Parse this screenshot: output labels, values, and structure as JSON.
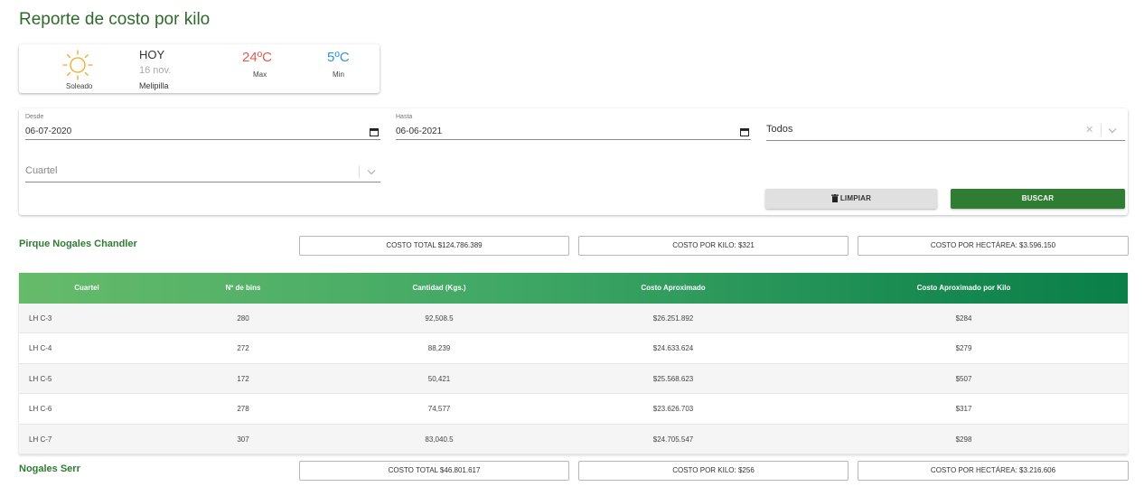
{
  "page": {
    "title": "Reporte de costo por kilo"
  },
  "weather": {
    "condition": "Soleado",
    "icon": "sun-icon",
    "day_label": "HOY",
    "date": "16 nov.",
    "location": "Melipilla",
    "max_temp": "24ºC",
    "max_label": "Max",
    "min_temp": "5ºC",
    "min_label": "Min",
    "colors": {
      "max": "#e05b52",
      "min": "#2d95d9",
      "sun": "#f5a623"
    }
  },
  "filters": {
    "desde": {
      "label": "Desde",
      "value": "06-07-2020"
    },
    "hasta": {
      "label": "Hasta",
      "value": "06-06-2021"
    },
    "campo_select": {
      "value": "Todos"
    },
    "cuartel_select": {
      "placeholder": "Cuartel"
    },
    "clear_label": "LIMPIAR",
    "search_label": "BUSCAR"
  },
  "sections": [
    {
      "name": "Pirque Nogales Chandler",
      "costo_total": "COSTO TOTAL $124.786.389",
      "costo_kilo": "COSTO POR KILO: $321",
      "costo_hectarea": "COSTO POR HECTÁREA: $3.596.150"
    },
    {
      "name": "Nogales Serr",
      "costo_total": "COSTO TOTAL $46.801.617",
      "costo_kilo": "COSTO POR KILO: $256",
      "costo_hectarea": "COSTO POR HECTÁREA: $3.216.606"
    }
  ],
  "table": {
    "headers": [
      "Cuartel",
      "Nº de bins",
      "Cantidad (Kgs.)",
      "Costo Aproximado",
      "Costo Aproximado por Kilo"
    ],
    "rows": [
      [
        "LH C-3",
        "280",
        "92,508.5",
        "$26.251.892",
        "$284"
      ],
      [
        "LH C-4",
        "272",
        "88,239",
        "$24.633.624",
        "$279"
      ],
      [
        "LH C-5",
        "172",
        "50,421",
        "$25.568.623",
        "$507"
      ],
      [
        "LH C-6",
        "278",
        "74,577",
        "$23.626.703",
        "$317"
      ],
      [
        "LH C-7",
        "307",
        "83,040.5",
        "$24.705.547",
        "$298"
      ]
    ]
  },
  "theme": {
    "accent": "#2e7d32",
    "header_gradient_start": "#66bb6a",
    "header_gradient_end": "#0a7f48"
  }
}
